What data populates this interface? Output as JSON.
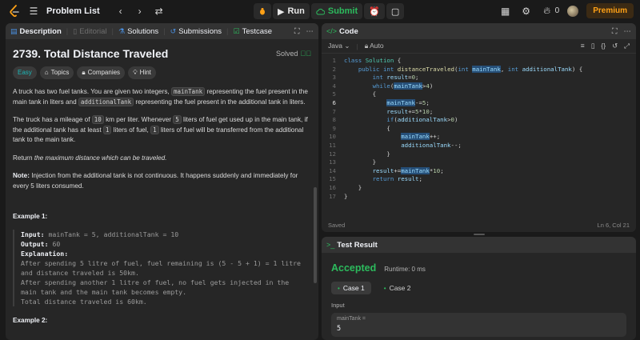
{
  "topbar": {
    "problem_list": "Problem List",
    "run": "Run",
    "submit": "Submit",
    "streak_count": "0",
    "premium": "Premium"
  },
  "left": {
    "tabs": [
      "Description",
      "Editorial",
      "Solutions",
      "Submissions",
      "Testcase"
    ],
    "title": "2739. Total Distance Traveled",
    "status": "Solved",
    "pills": [
      "Easy",
      "Topics",
      "Companies",
      "Hint"
    ],
    "p1": {
      "a": "A truck has two fuel tanks. You are given two integers, ",
      "c1": "mainTank",
      "b": " representing the fuel present in the main tank in liters and ",
      "c2": "additionalTank",
      "d": " representing the fuel present in the additional tank in liters."
    },
    "p2": {
      "a": "The truck has a mileage of ",
      "c1": "10",
      "b": " km per liter. Whenever ",
      "c2": "5",
      "c": " liters of fuel get used up in the main tank, if the additional tank has at least ",
      "c3": "1",
      "d": " liters of fuel, ",
      "c4": "1",
      "e": " liters of fuel will be transferred from the additional tank to the main tank."
    },
    "p3": {
      "a": "Return ",
      "em": "the maximum distance which can be traveled.",
      "b": ""
    },
    "p4": {
      "note_label": "Note:",
      "text": " Injection from the additional tank is not continuous. It happens suddenly and immediately for every 5 liters consumed."
    },
    "example1": {
      "heading": "Example 1:",
      "input_label": "Input:",
      "input_val": " mainTank = 5, additionalTank = 10",
      "output_label": "Output:",
      "output_val": " 60",
      "explanation_label": "Explanation:",
      "lines": [
        "After spending 5 litre of fuel, fuel remaining is (5 - 5 + 1) = 1 litre",
        "and distance traveled is 50km.",
        "After spending another 1 litre of fuel, no fuel gets injected in the",
        "main tank and the main tank becomes empty.",
        "Total distance traveled is 60km."
      ]
    },
    "example2_heading": "Example 2:"
  },
  "code": {
    "header": "Code",
    "language": "Java",
    "mode": "Auto",
    "footer_left": "Saved",
    "footer_right": "Ln 6, Col 21",
    "line_numbers": [
      "1",
      "2",
      "3",
      "4",
      "5",
      "6",
      "7",
      "8",
      "9",
      "10",
      "11",
      "12",
      "13",
      "14",
      "15",
      "16",
      "17"
    ]
  },
  "test": {
    "header": "Test Result",
    "accepted": "Accepted",
    "runtime": "Runtime: 0 ms",
    "case1": "Case 1",
    "case2": "Case 2",
    "input_label": "Input",
    "param_name": "mainTank =",
    "param_value": "5"
  }
}
